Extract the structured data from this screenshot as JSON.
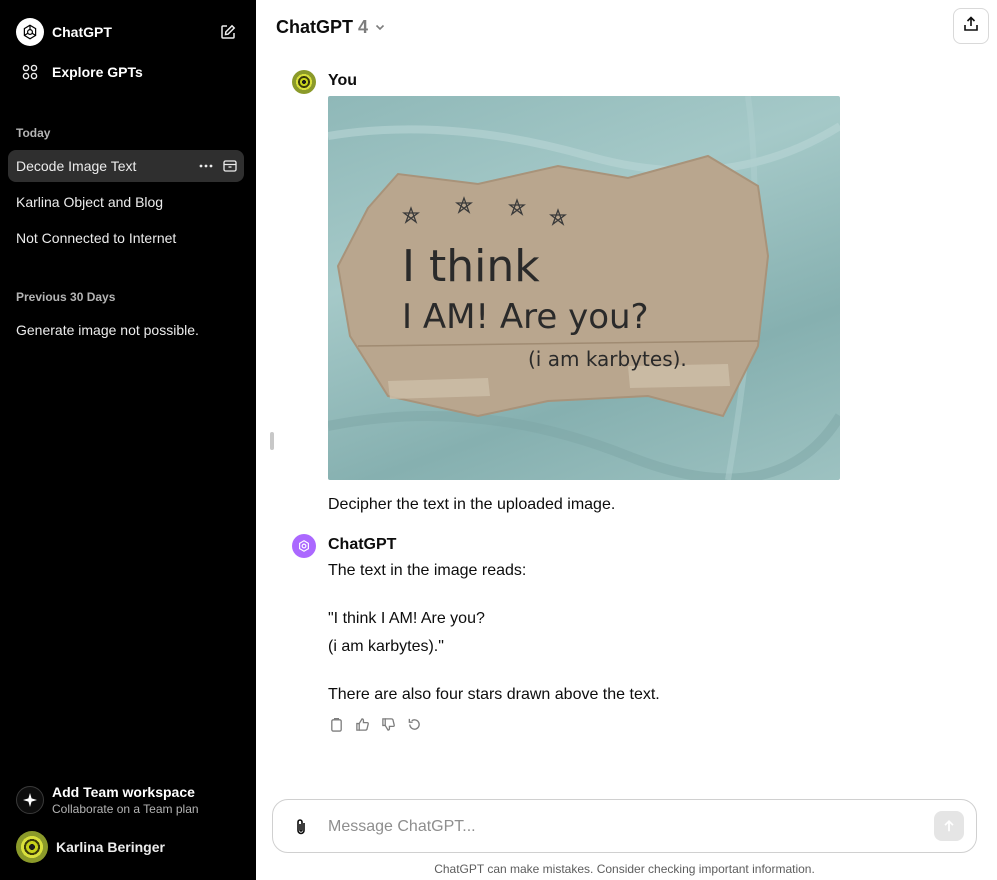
{
  "sidebar": {
    "brand": "ChatGPT",
    "explore": "Explore GPTs",
    "sections": [
      {
        "label": "Today",
        "items": [
          "Decode Image Text",
          "Karlina Object and Blog",
          "Not Connected to Internet"
        ]
      },
      {
        "label": "Previous 30 Days",
        "items": [
          "Generate image not possible."
        ]
      }
    ],
    "team": {
      "title": "Add Team workspace",
      "subtitle": "Collaborate on a Team plan"
    },
    "user_name": "Karlina Beringer"
  },
  "header": {
    "model": "ChatGPT",
    "version": "4"
  },
  "conversation": {
    "user_author": "You",
    "user_image_text": {
      "line1": "I think",
      "line2": "I AM! Are you?",
      "line3": "(i am karbytes)."
    },
    "user_message": "Decipher the text in the uploaded image.",
    "assistant_author": "ChatGPT",
    "assistant_lines": [
      "The text in the image reads:",
      "\"I think I AM! Are you?",
      "(i am karbytes).\"",
      "There are also four stars drawn above the text."
    ]
  },
  "composer": {
    "placeholder": "Message ChatGPT..."
  },
  "disclaimer": "ChatGPT can make mistakes. Consider checking important information.",
  "colors": {
    "sidebar_bg": "#000000",
    "active_item": "#2f2f2f",
    "assistant_avatar": "#ab68ff"
  }
}
